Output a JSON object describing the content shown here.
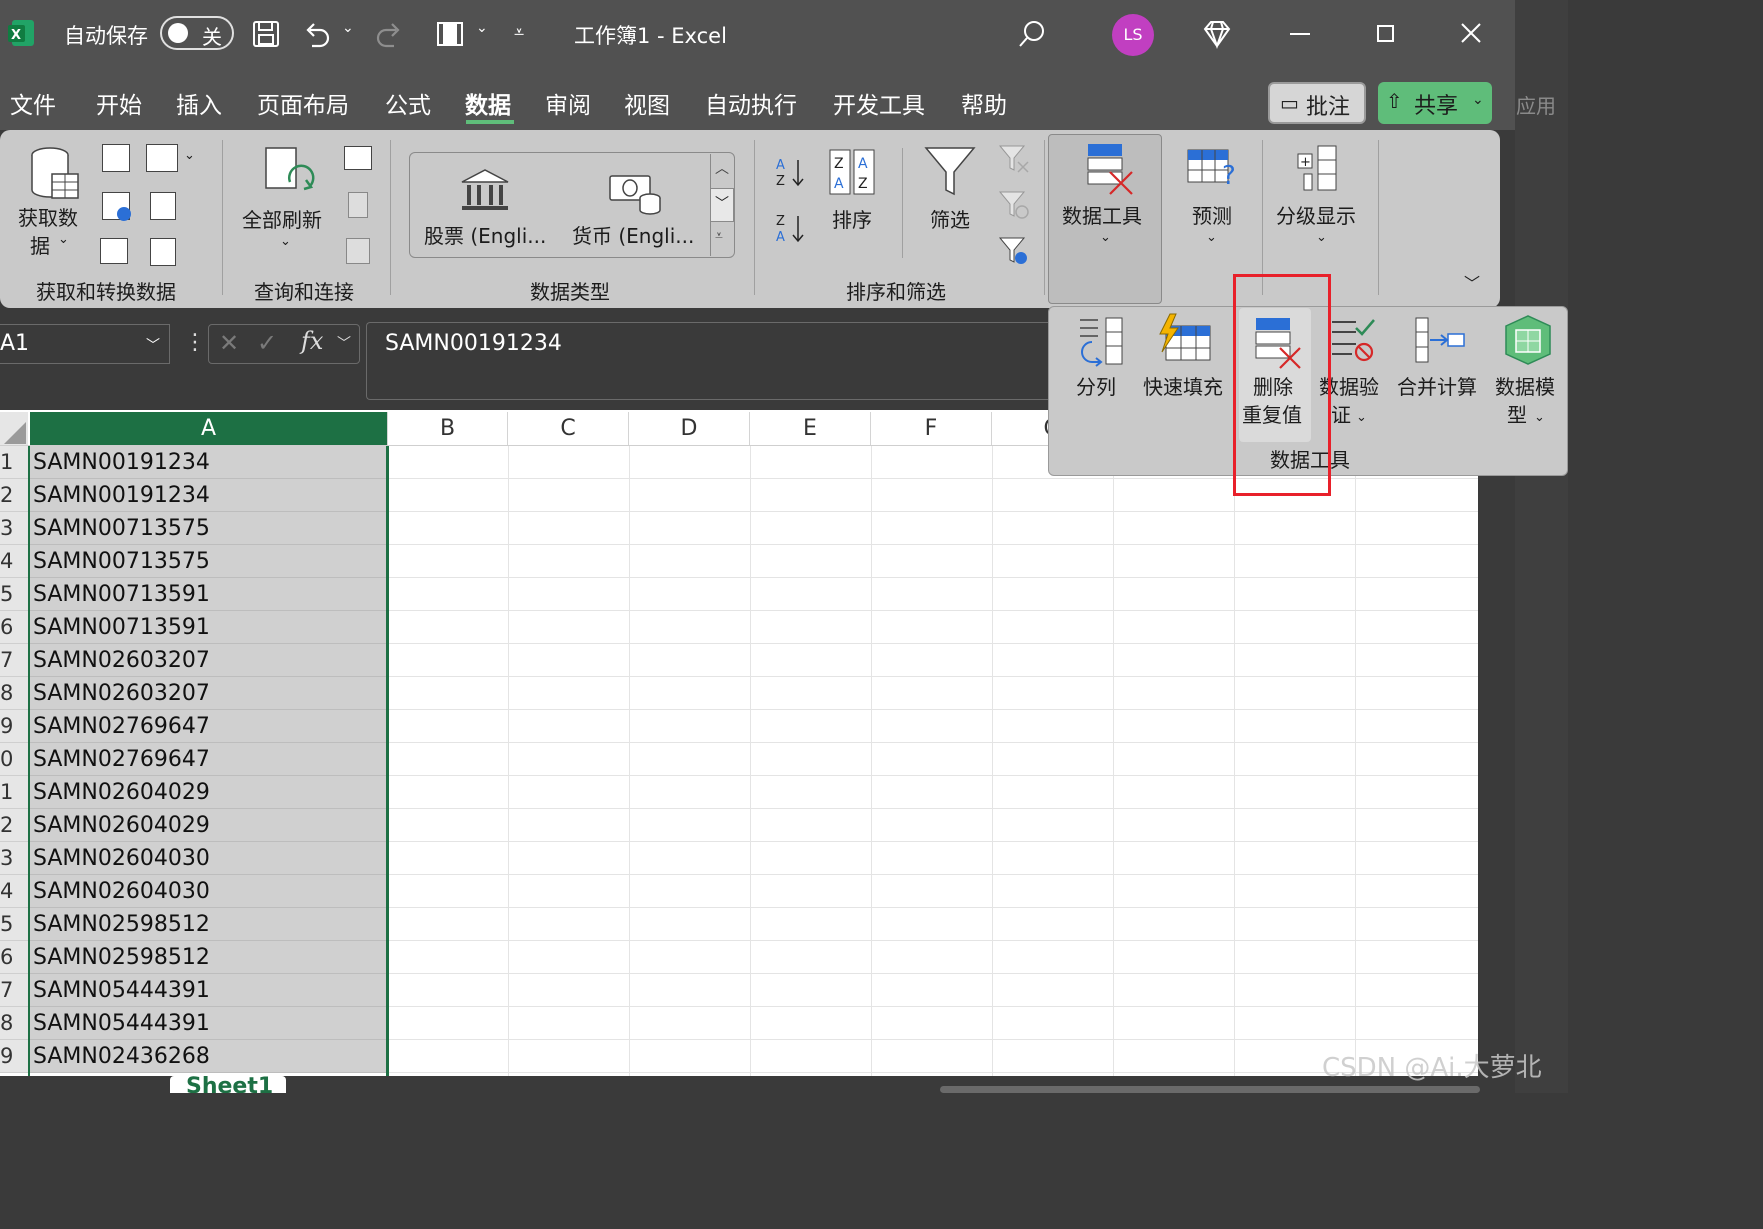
{
  "titlebar": {
    "autosave_label": "自动保存",
    "autosave_toggle": "关",
    "doc_title": "工作簿1  -  Excel",
    "avatar": "LS"
  },
  "menu": {
    "tabs": [
      "文件",
      "开始",
      "插入",
      "页面布局",
      "公式",
      "数据",
      "审阅",
      "视图",
      "自动执行",
      "开发工具",
      "帮助"
    ],
    "active": "数据",
    "comments": "批注",
    "share": "共享",
    "apply": "应用"
  },
  "ribbon": {
    "get_data": "获取数",
    "get_data2": "据",
    "group_get": "获取和转换数据",
    "refresh_all": "全部刷新",
    "group_query": "查询和连接",
    "stocks": "股票 (Engli...",
    "currency": "货币 (Engli...",
    "group_types": "数据类型",
    "sort": "排序",
    "filter": "筛选",
    "group_sort": "排序和筛选",
    "data_tools": "数据工具",
    "forecast": "预测",
    "outline": "分级显示"
  },
  "formula": {
    "name_box": "A1",
    "fx": "fx",
    "value": "SAMN00191234"
  },
  "popup": {
    "text_to_columns": "分列",
    "flash_fill": "快速填充",
    "remove_dup_1": "删除",
    "remove_dup_2": "重复值",
    "validation_1": "数据验",
    "validation_2": "证",
    "consolidate": "合并计算",
    "data_model_1": "数据模",
    "data_model_2": "型",
    "group_label": "数据工具"
  },
  "grid": {
    "columns": [
      "A",
      "B",
      "C",
      "D",
      "E",
      "F",
      "G"
    ],
    "row_numbers": [
      "1",
      "2",
      "3",
      "4",
      "5",
      "6",
      "7",
      "8",
      "9",
      "0",
      "1",
      "2",
      "3",
      "4",
      "5",
      "6",
      "7",
      "8",
      "9"
    ],
    "cells": [
      "SAMN00191234",
      "SAMN00191234",
      "SAMN00713575",
      "SAMN00713575",
      "SAMN00713591",
      "SAMN00713591",
      "SAMN02603207",
      "SAMN02603207",
      "SAMN02769647",
      "SAMN02769647",
      "SAMN02604029",
      "SAMN02604029",
      "SAMN02604030",
      "SAMN02604030",
      "SAMN02598512",
      "SAMN02598512",
      "SAMN05444391",
      "SAMN05444391",
      "SAMN02436268"
    ]
  },
  "sheet_tab": "Sheet1",
  "watermark": "CSDN @Ai.大萝北",
  "colors": {
    "excel_green": "#1d7044",
    "share_green": "#5fbd7a",
    "avatar": "#c13fc1",
    "highlight": "#e8202a"
  }
}
